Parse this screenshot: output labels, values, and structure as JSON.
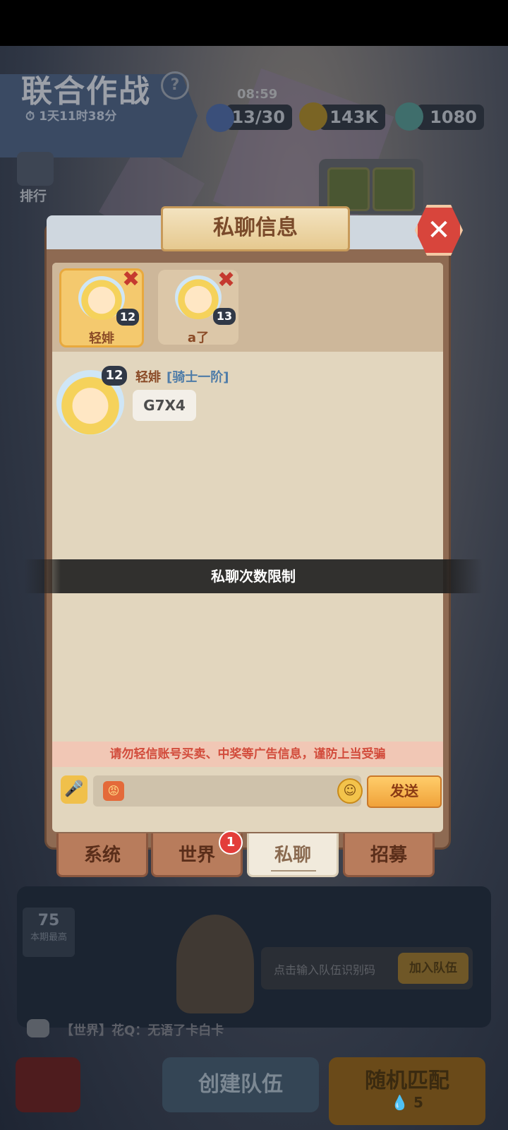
{
  "background": {
    "game_title": "联合作战",
    "help_icon": "?",
    "event_timer": "1天11时38分",
    "clock": "08:59",
    "resources": {
      "stamina": "13/30",
      "gold": "143K",
      "gems": "1080"
    },
    "rank_label": "排行",
    "best_number": "75",
    "best_label": "本期最高",
    "team_code_placeholder": "点击输入队伍识别码",
    "join_team_label": "加入队伍",
    "world_feed": "【世界】花Q：无语了卡白卡",
    "create_team_label": "创建队伍",
    "random_match_label": "随机匹配",
    "random_match_cost": "5"
  },
  "dialog": {
    "title": "私聊信息",
    "close_icon": "✕",
    "contacts": [
      {
        "name": "轻婔",
        "level": "12",
        "remove_icon": "✖",
        "active": true
      },
      {
        "name": "a了",
        "level": "13",
        "remove_icon": "✖",
        "active": false
      }
    ],
    "messages": [
      {
        "sender": "轻婔",
        "rank": "[骑士一阶]",
        "level": "12",
        "text": "G7X4"
      }
    ],
    "toast": "私聊次数限制",
    "warning": "请勿轻信账号买卖、中奖等广告信息，谨防上当受骗",
    "input": {
      "value": "",
      "placeholder": ""
    },
    "send_label": "发送",
    "tabs": [
      {
        "label": "系统"
      },
      {
        "label": "世界",
        "badge": "1"
      },
      {
        "label": "私聊",
        "active": true
      },
      {
        "label": "招募"
      }
    ]
  },
  "colors": {
    "close_red": "#d8453c",
    "send_orange": "#f0a23a",
    "warning_red": "#d24c3c",
    "rank_blue": "#4e7ca8",
    "name_brown": "#8a4a26"
  }
}
